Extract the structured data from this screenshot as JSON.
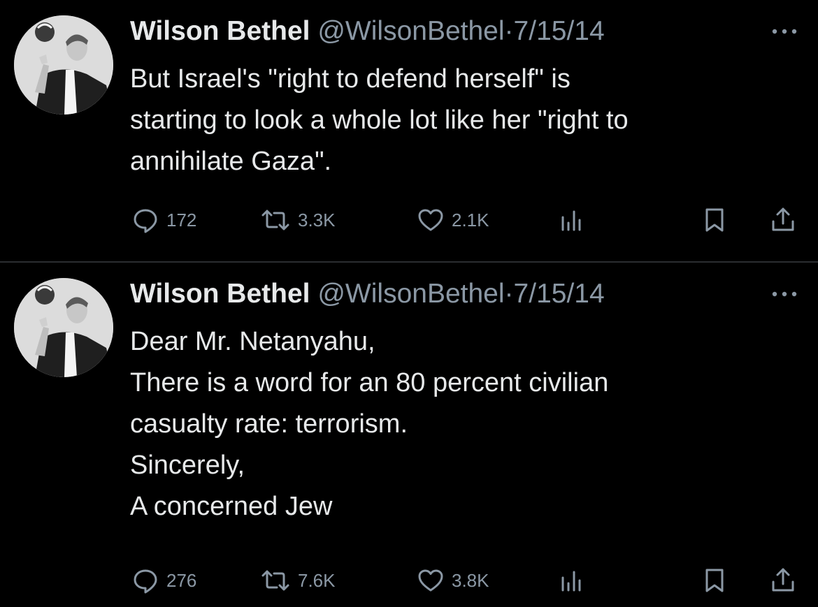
{
  "tweets": [
    {
      "author_name": "Wilson Bethel",
      "handle": "@WilsonBethel",
      "separator": "·",
      "date": "7/15/14",
      "lines": [
        "But Israel's \"right to defend herself\" is",
        "starting to look a whole lot like her \"right to",
        "annihilate Gaza\"."
      ],
      "stats": {
        "replies": "172",
        "retweets": "3.3K",
        "likes": "2.1K"
      }
    },
    {
      "author_name": "Wilson Bethel",
      "handle": "@WilsonBethel",
      "separator": "·",
      "date": "7/15/14",
      "lines": [
        "Dear Mr. Netanyahu,",
        "There is a word for an 80 percent civilian",
        "casualty rate: terrorism.",
        "Sincerely,",
        "A concerned Jew"
      ],
      "stats": {
        "replies": "276",
        "retweets": "7.6K",
        "likes": "3.8K"
      }
    }
  ],
  "icons": {
    "more": "more-horizontal-icon",
    "reply": "speech-bubble-icon",
    "retweet": "retweet-arrows-icon",
    "like": "heart-icon",
    "views": "bar-chart-icon",
    "bookmark": "bookmark-icon",
    "share": "share-upload-icon"
  },
  "colors": {
    "background": "#000000",
    "primary_text": "#e7e9ea",
    "secondary_text": "#8b98a5",
    "divider": "#2a2d30"
  }
}
